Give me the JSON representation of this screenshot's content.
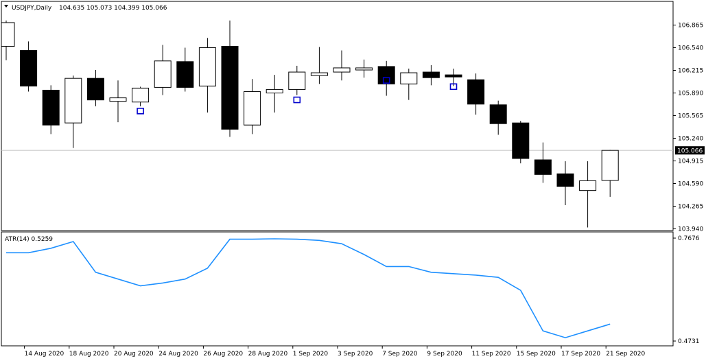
{
  "header": {
    "symbol_label": "USDJPY,Daily",
    "ohlc_label": "104.635 105.073 104.399 105.066",
    "menu_icon": "triangle-down-icon"
  },
  "atr_panel": {
    "label": "ATR(14) 0.5259"
  },
  "colors": {
    "bull_fill": "#ffffff",
    "bear_fill": "#000000",
    "candle_stroke": "#000000",
    "atr_line": "#1e90ff",
    "fractal_marker": "#0000cd",
    "current_price_line": "#c0c0c0",
    "background": "#ffffff"
  },
  "chart_data": [
    {
      "type": "candlestick",
      "title": "USDJPY,Daily",
      "ylim": [
        103.85,
        107.08
      ],
      "y_ticks": [
        "106.865",
        "106.540",
        "106.215",
        "105.890",
        "105.565",
        "105.240",
        "104.915",
        "104.590",
        "104.265",
        "103.940"
      ],
      "current_price": "105.066",
      "x_tick_labels": [
        "14 Aug 2020",
        "18 Aug 2020",
        "20 Aug 2020",
        "24 Aug 2020",
        "26 Aug 2020",
        "28 Aug 2020",
        "1 Sep 2020",
        "3 Sep 2020",
        "7 Sep 2020",
        "9 Sep 2020",
        "11 Sep 2020",
        "15 Sep 2020",
        "17 Sep 2020",
        "21 Sep 2020"
      ],
      "candles": [
        {
          "date": "13 Aug 2020",
          "open": 106.56,
          "high": 106.93,
          "low": 106.36,
          "close": 106.9
        },
        {
          "date": "14 Aug 2020",
          "open": 106.5,
          "high": 106.63,
          "low": 105.91,
          "close": 105.99
        },
        {
          "date": "17 Aug 2020",
          "open": 105.93,
          "high": 106.0,
          "low": 105.3,
          "close": 105.43
        },
        {
          "date": "18 Aug 2020",
          "open": 105.46,
          "high": 106.14,
          "low": 105.1,
          "close": 106.1
        },
        {
          "date": "19 Aug 2020",
          "open": 106.1,
          "high": 106.22,
          "low": 105.7,
          "close": 105.79
        },
        {
          "date": "20 Aug 2020",
          "open": 105.77,
          "high": 106.07,
          "low": 105.47,
          "close": 105.82
        },
        {
          "date": "21 Aug 2020",
          "open": 105.76,
          "high": 105.98,
          "low": 105.7,
          "close": 105.96
        },
        {
          "date": "24 Aug 2020",
          "open": 105.97,
          "high": 106.58,
          "low": 105.86,
          "close": 106.35
        },
        {
          "date": "25 Aug 2020",
          "open": 106.34,
          "high": 106.54,
          "low": 105.91,
          "close": 105.97
        },
        {
          "date": "26 Aug 2020",
          "open": 105.99,
          "high": 106.68,
          "low": 105.61,
          "close": 106.54
        },
        {
          "date": "27 Aug 2020",
          "open": 106.56,
          "high": 106.93,
          "low": 105.26,
          "close": 105.37
        },
        {
          "date": "28 Aug 2020",
          "open": 105.43,
          "high": 106.09,
          "low": 105.3,
          "close": 105.91
        },
        {
          "date": "31 Aug 2020",
          "open": 105.89,
          "high": 106.15,
          "low": 105.61,
          "close": 105.94
        },
        {
          "date": "1 Sep 2020",
          "open": 105.94,
          "high": 106.28,
          "low": 105.86,
          "close": 106.19
        },
        {
          "date": "2 Sep 2020",
          "open": 106.14,
          "high": 106.55,
          "low": 106.02,
          "close": 106.18
        },
        {
          "date": "3 Sep 2020",
          "open": 106.19,
          "high": 106.5,
          "low": 106.07,
          "close": 106.25
        },
        {
          "date": "4 Sep 2020",
          "open": 106.22,
          "high": 106.37,
          "low": 106.11,
          "close": 106.25
        },
        {
          "date": "7 Sep 2020",
          "open": 106.27,
          "high": 106.35,
          "low": 105.85,
          "close": 106.02
        },
        {
          "date": "8 Sep 2020",
          "open": 106.02,
          "high": 106.24,
          "low": 105.79,
          "close": 106.18
        },
        {
          "date": "9 Sep 2020",
          "open": 106.19,
          "high": 106.29,
          "low": 106.0,
          "close": 106.11
        },
        {
          "date": "10 Sep 2020",
          "open": 106.15,
          "high": 106.24,
          "low": 105.99,
          "close": 106.12
        },
        {
          "date": "11 Sep 2020",
          "open": 106.08,
          "high": 106.17,
          "low": 105.58,
          "close": 105.73
        },
        {
          "date": "14 Sep 2020",
          "open": 105.72,
          "high": 105.78,
          "low": 105.29,
          "close": 105.45
        },
        {
          "date": "15 Sep 2020",
          "open": 105.46,
          "high": 105.49,
          "low": 104.88,
          "close": 104.95
        },
        {
          "date": "16 Sep 2020",
          "open": 104.93,
          "high": 105.18,
          "low": 104.6,
          "close": 104.72
        },
        {
          "date": "17 Sep 2020",
          "open": 104.73,
          "high": 104.91,
          "low": 104.28,
          "close": 104.55
        },
        {
          "date": "18 Sep 2020",
          "open": 104.49,
          "high": 104.91,
          "low": 103.96,
          "close": 104.63
        },
        {
          "date": "21 Sep 2020",
          "open": 104.635,
          "high": 105.073,
          "low": 104.399,
          "close": 105.066
        }
      ],
      "fractals": [
        {
          "date": "21 Aug 2020",
          "value": 105.7
        },
        {
          "date": "1 Sep 2020",
          "value": 105.86
        },
        {
          "date": "7 Sep 2020",
          "value": 106.14
        },
        {
          "date": "10 Sep 2020",
          "value": 106.05
        }
      ]
    },
    {
      "type": "line",
      "title": "ATR(14) 0.5259",
      "ylim": [
        0.4731,
        0.7676
      ],
      "y_ticks": [
        "0.7676",
        "0.4731"
      ],
      "series": [
        {
          "name": "ATR(14)",
          "dates": [
            "13 Aug 2020",
            "14 Aug 2020",
            "17 Aug 2020",
            "18 Aug 2020",
            "19 Aug 2020",
            "21 Aug 2020",
            "24 Aug 2020",
            "25 Aug 2020",
            "26 Aug 2020",
            "27 Aug 2020",
            "28 Aug 2020",
            "31 Aug 2020",
            "1 Sep 2020",
            "2 Sep 2020",
            "3 Sep 2020",
            "4 Sep 2020",
            "7 Sep 2020",
            "8 Sep 2020",
            "9 Sep 2020",
            "11 Sep 2020",
            "14 Sep 2020",
            "15 Sep 2020",
            "16 Sep 2020",
            "17 Sep 2020",
            "18 Sep 2020",
            "21 Sep 2020"
          ],
          "values": [
            0.7258,
            0.7258,
            0.7386,
            0.7578,
            0.6698,
            0.6311,
            0.6392,
            0.6504,
            0.6814,
            0.7644,
            0.7644,
            0.7657,
            0.7644,
            0.7612,
            0.7515,
            0.7206,
            0.6863,
            0.6863,
            0.6698,
            0.6618,
            0.6553,
            0.6182,
            0.5022,
            0.4828,
            0.5022,
            0.5216
          ]
        }
      ]
    }
  ]
}
